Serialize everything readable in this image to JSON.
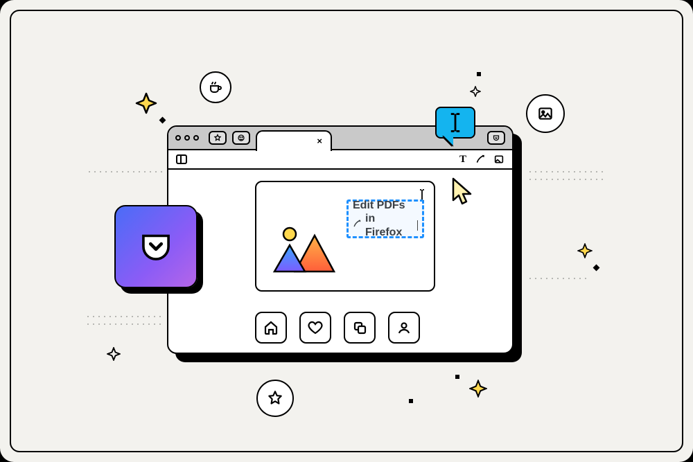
{
  "editor": {
    "line1": "Edit PDFs",
    "line2": "in Firefox"
  },
  "toolbar": {
    "text_tool": "T"
  },
  "speech": {
    "glyph": "I"
  }
}
